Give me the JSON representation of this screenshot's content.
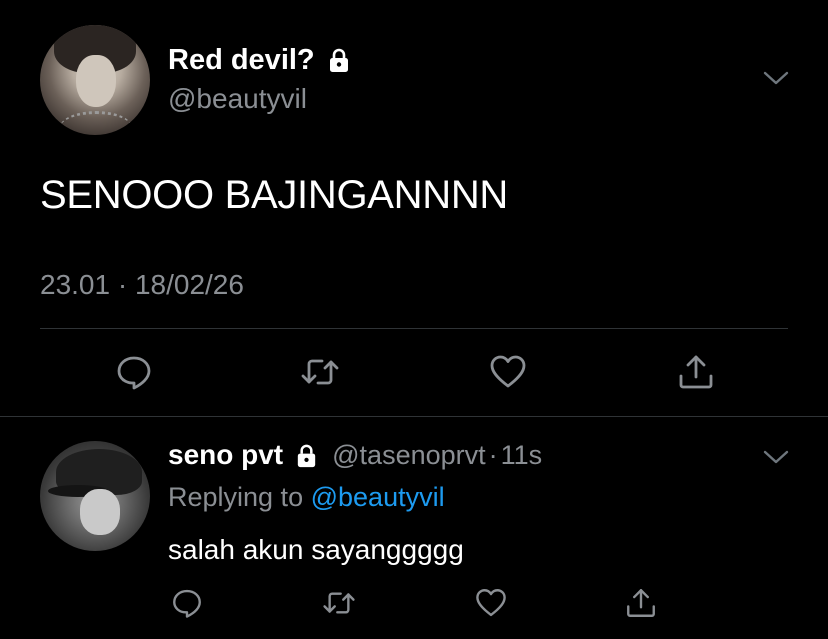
{
  "main_tweet": {
    "display_name": "Red devil?",
    "handle": "@beautyvil",
    "text": "SENOOO BAJINGANNNN",
    "timestamp": "23.01 · 18/02/26",
    "actions": [
      "reply-icon",
      "retweet-icon",
      "like-icon",
      "share-icon"
    ]
  },
  "reply_tweet": {
    "display_name": "seno pvt",
    "handle": "@tasenoprvt",
    "separator": "·",
    "time": "11s",
    "replying_to_prefix": "Replying to",
    "replying_to_handle": "@beautyvil",
    "text": "salah akun sayanggggg",
    "actions": [
      "reply-icon",
      "retweet-icon",
      "like-icon",
      "share-icon"
    ]
  },
  "colors": {
    "background": "#000000",
    "primary_text": "#ffffff",
    "secondary_text": "#8b8f94",
    "link": "#1d9bf0",
    "divider": "#2f3336"
  }
}
